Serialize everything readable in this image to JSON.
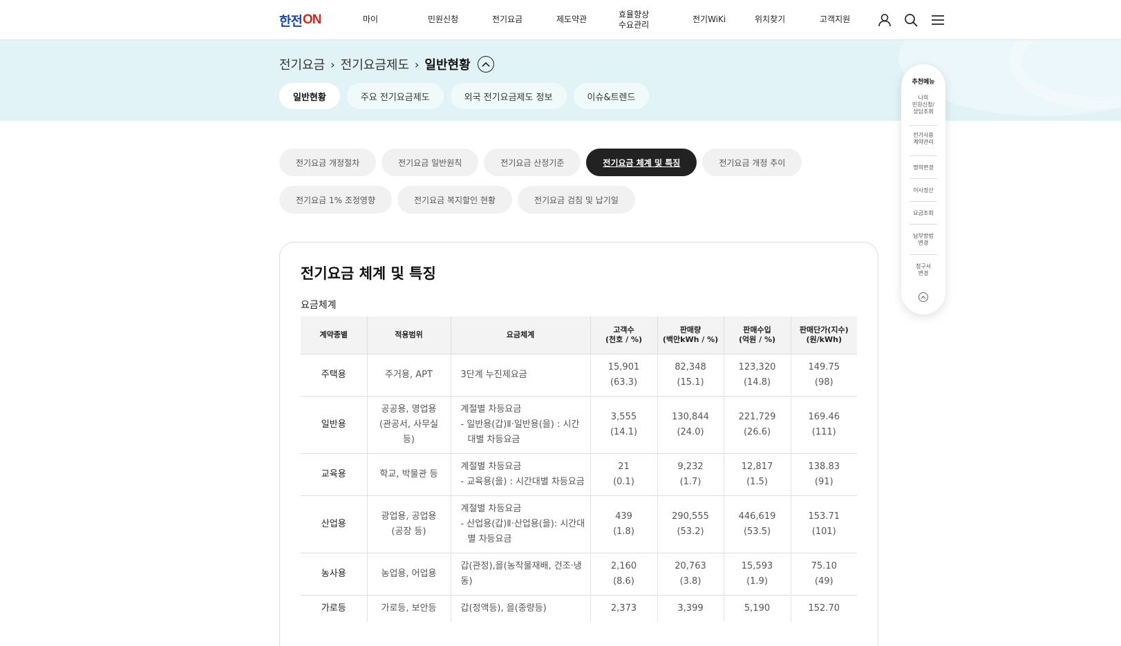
{
  "header": {
    "logo_part1": "한전",
    "logo_part2": "ON",
    "nav": [
      "마이",
      "민원신청",
      "전기요금",
      "제도약관",
      "효율향상\n수요관리",
      "전기WiKi",
      "위치찾기",
      "고객지원"
    ],
    "icons": [
      "user-icon",
      "search-icon",
      "menu-icon"
    ]
  },
  "breadcrumb": {
    "items": [
      "전기요금",
      "전기요금제도",
      "일반현황"
    ]
  },
  "tabs": [
    "일반현황",
    "주요 전기요금제도",
    "외국 전기요금제도 정보",
    "이슈&트렌드"
  ],
  "subtabs": [
    "전기요금 개정절차",
    "전기요금 일반원칙",
    "전기요금 산정기준",
    "전기요금 체계 및 특징",
    "전기요금 개정 추이",
    "전기요금 1% 조정영향",
    "전기요금 복지할인 현황",
    "전기요금 검침 및 납기일"
  ],
  "content": {
    "title": "전기요금 체계 및 특징",
    "section": "요금체계",
    "table": {
      "headers": [
        "계약종별",
        "적용범위",
        "요금체계",
        "고객수\n(천호 / %)",
        "판매량\n(백만kWh / %)",
        "판매수입\n(억원 / %)",
        "판매단가(지수)\n(원/kWh)"
      ],
      "rows": [
        {
          "type": "주택용",
          "scope": "주거용, APT",
          "scheme": [
            "3단계 누진제요금"
          ],
          "customers": [
            "15,901",
            "(63.3)"
          ],
          "sales": [
            "82,348",
            "(15.1)"
          ],
          "revenue": [
            "123,320",
            "(14.8)"
          ],
          "price": [
            "149.75",
            "(98)"
          ]
        },
        {
          "type": "일반용",
          "scope": "공공용, 영업용\n(관공서, 사무실\n등)",
          "scheme": [
            "계절별 차등요금",
            "- 일반용(갑)Ⅱ·일반용(을) : 시간대별 차등요금"
          ],
          "customers": [
            "3,555",
            "(14.1)"
          ],
          "sales": [
            "130,844",
            "(24.0)"
          ],
          "revenue": [
            "221,729",
            "(26.6)"
          ],
          "price": [
            "169.46",
            "(111)"
          ]
        },
        {
          "type": "교육용",
          "scope": "학교, 박물관 등",
          "scheme": [
            "계절별 차등요금",
            "- 교육용(을) : 시간대별 차등요금"
          ],
          "customers": [
            "21",
            "(0.1)"
          ],
          "sales": [
            "9,232",
            "(1.7)"
          ],
          "revenue": [
            "12,817",
            "(1.5)"
          ],
          "price": [
            "138.83",
            "(91)"
          ]
        },
        {
          "type": "산업용",
          "scope": "광업용, 공업용\n(공장 등)",
          "scheme": [
            "계절별 차등요금",
            "- 산업용(갑)Ⅱ·산업용(을): 시간대별 차등요금"
          ],
          "customers": [
            "439",
            "(1.8)"
          ],
          "sales": [
            "290,555",
            "(53.2)"
          ],
          "revenue": [
            "446,619",
            "(53.5)"
          ],
          "price": [
            "153.71",
            "(101)"
          ]
        },
        {
          "type": "농사용",
          "scope": "농업용, 어업용",
          "scheme": [
            "갑(관정),을(농작물재배, 건조·냉동)"
          ],
          "customers": [
            "2,160",
            "(8.6)"
          ],
          "sales": [
            "20,763",
            "(3.8)"
          ],
          "revenue": [
            "15,593",
            "(1.9)"
          ],
          "price": [
            "75.10",
            "(49)"
          ]
        },
        {
          "type": "가로등",
          "scope": "가로등, 보안등",
          "scheme": [
            "갑(정액등), 을(종량등)"
          ],
          "customers": [
            "2,373",
            ""
          ],
          "sales": [
            "3,399",
            ""
          ],
          "revenue": [
            "5,190",
            ""
          ],
          "price": [
            "152.70",
            ""
          ]
        }
      ]
    }
  },
  "floatmenu": {
    "title": "추천메뉴",
    "items": [
      "나의\n민원신청/\n상담조회",
      "전기사용\n계약관리",
      "명의변경",
      "이사정산",
      "요금조회",
      "납부방법\n변경",
      "청구서\n변경"
    ]
  }
}
